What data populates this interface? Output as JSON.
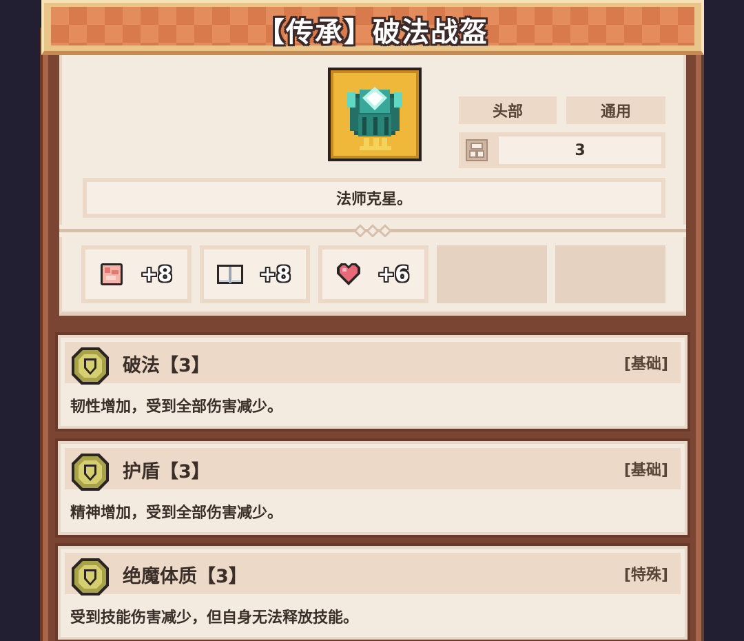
{
  "title": "【传承】破法战盔",
  "item": {
    "icon": "helmet-icon",
    "part": "头部",
    "type": "通用",
    "slot_count": "3",
    "description": "法师克星。"
  },
  "stats": [
    {
      "icon": "fist-icon",
      "value": "+8"
    },
    {
      "icon": "book-icon",
      "value": "+8"
    },
    {
      "icon": "heart-icon",
      "value": "+6"
    }
  ],
  "skills": [
    {
      "name": "破法【3】",
      "category": "[基础]",
      "description": "韧性增加，受到全部伤害减少。",
      "icon": "shield-icon"
    },
    {
      "name": "护盾【3】",
      "category": "[基础]",
      "description": "精神增加，受到全部伤害减少。",
      "icon": "shield-icon"
    },
    {
      "name": "绝魔体质【3】",
      "category": "[特殊]",
      "description": "受到技能伤害减少，但自身无法释放技能。",
      "icon": "shield-icon"
    }
  ],
  "colors": {
    "accent_orange": "#e48c5c",
    "panel_brown": "#7a4633",
    "card_bg": "#f4ebe0",
    "gold": "#f0b83a",
    "teal": "#2fb7a3"
  }
}
